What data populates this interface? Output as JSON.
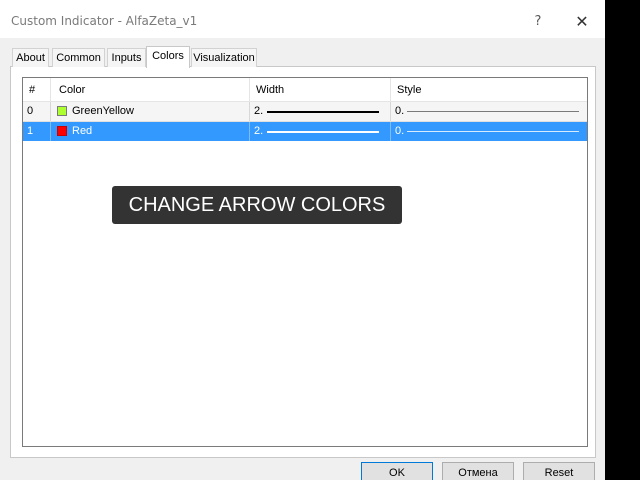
{
  "window": {
    "title": "Custom Indicator - AlfaZeta_v1",
    "help_glyph": "?",
    "close_glyph": "✕"
  },
  "tabs": [
    {
      "label": "About",
      "active": false
    },
    {
      "label": "Common",
      "active": false
    },
    {
      "label": "Inputs",
      "active": false
    },
    {
      "label": "Colors",
      "active": true
    },
    {
      "label": "Visualization",
      "active": false
    }
  ],
  "table": {
    "columns": [
      "#",
      "Color",
      "Width",
      "Style"
    ],
    "rows": [
      {
        "index": "0",
        "color_name": "GreenYellow",
        "swatch": "#adff2f",
        "width": "2.",
        "style": "0.",
        "selected": false
      },
      {
        "index": "1",
        "color_name": "Red",
        "swatch": "#ff0000",
        "width": "2.",
        "style": "0.",
        "selected": true
      }
    ]
  },
  "overlay_text": "CHANGE ARROW COLORS",
  "buttons": {
    "ok": "OK",
    "cancel": "Отмена",
    "reset": "Reset"
  },
  "colors": {
    "selection": "#3399ff",
    "background": "#f0f0f0",
    "overlay": "#333333"
  }
}
